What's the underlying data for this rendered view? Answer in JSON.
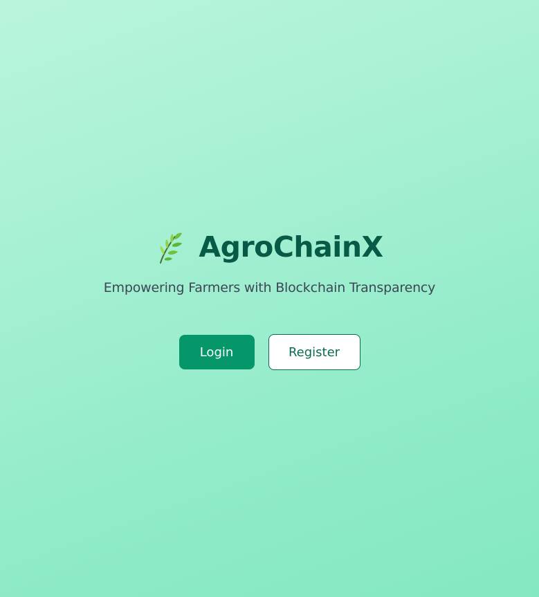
{
  "brand": {
    "icon": "herb-sprig-icon",
    "title": "AgroChainX"
  },
  "tagline": "Empowering Farmers with Blockchain Transparency",
  "actions": {
    "login_label": "Login",
    "register_label": "Register"
  },
  "colors": {
    "background_start": "#b9f5dc",
    "background_end": "#84e8c0",
    "title": "#075a45",
    "primary": "#059669",
    "tagline": "#3c4656"
  }
}
